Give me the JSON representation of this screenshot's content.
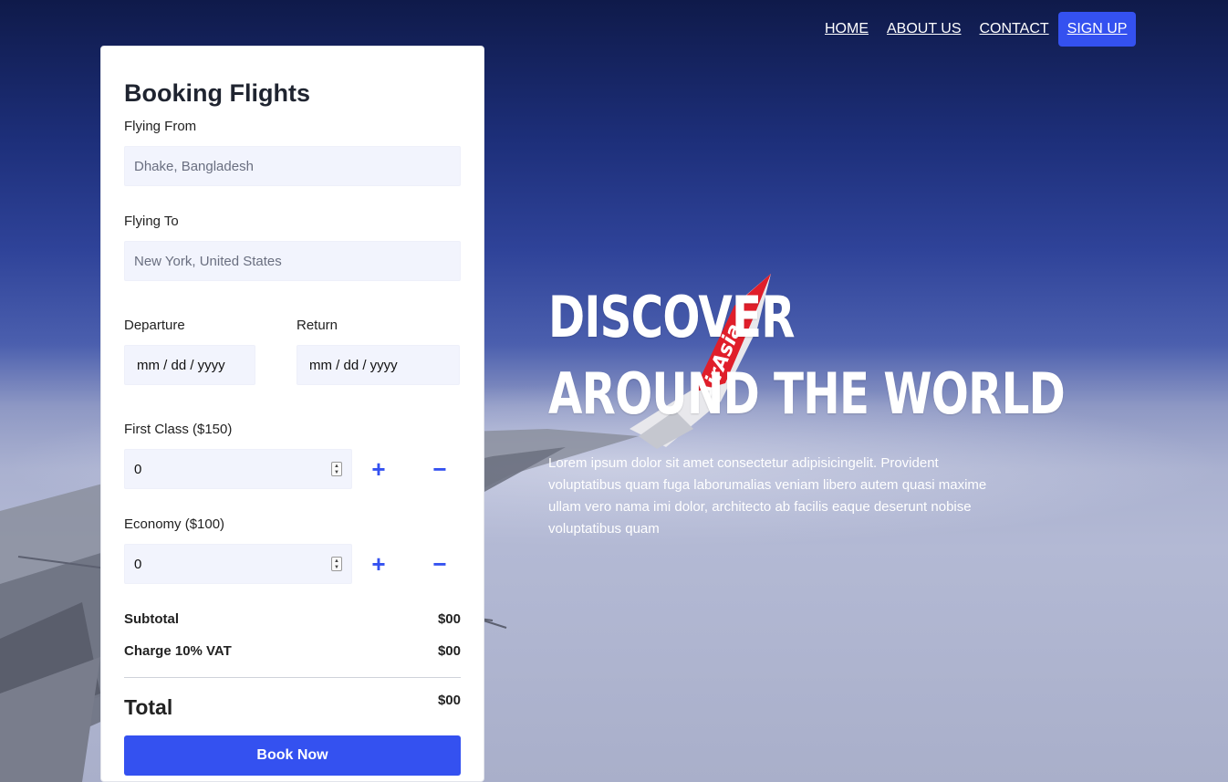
{
  "nav": {
    "items": [
      {
        "label": "HOME"
      },
      {
        "label": "ABOUT US"
      },
      {
        "label": "CONTACT"
      },
      {
        "label": "SIGN UP"
      }
    ]
  },
  "booking": {
    "title": "Booking Flights",
    "from": {
      "label": "Flying From",
      "placeholder": "Dhake, Bangladesh"
    },
    "to": {
      "label": "Flying To",
      "placeholder": "New York, United States"
    },
    "departure": {
      "label": "Departure",
      "value": "mm / dd / yyyy"
    },
    "return": {
      "label": "Return",
      "value": "mm / dd / yyyy"
    },
    "first_class": {
      "label": "First Class ($150)",
      "value": "0"
    },
    "economy": {
      "label": "Economy ($100)",
      "value": "0"
    },
    "subtotal": {
      "label": "Subtotal",
      "value": "$00"
    },
    "vat": {
      "label": "Charge 10% VAT",
      "value": "$00"
    },
    "total": {
      "label": "Total",
      "value": "$00"
    },
    "book_label": "Book Now"
  },
  "hero": {
    "line1": "DISCOVER",
    "line2": "AROUND THE WORLD",
    "body": "Lorem ipsum dolor sit amet consectetur adipisicingelit. Provident voluptatibus quam fuga laborumalias veniam libero autem quasi maxime ullam vero nama imi dolor, architecto ab facilis eaque deserunt nobise voluptatibus quam"
  },
  "wing_logo": "AirAsia",
  "colors": {
    "accent": "#3451f0",
    "field_bg": "#f2f4fd"
  }
}
